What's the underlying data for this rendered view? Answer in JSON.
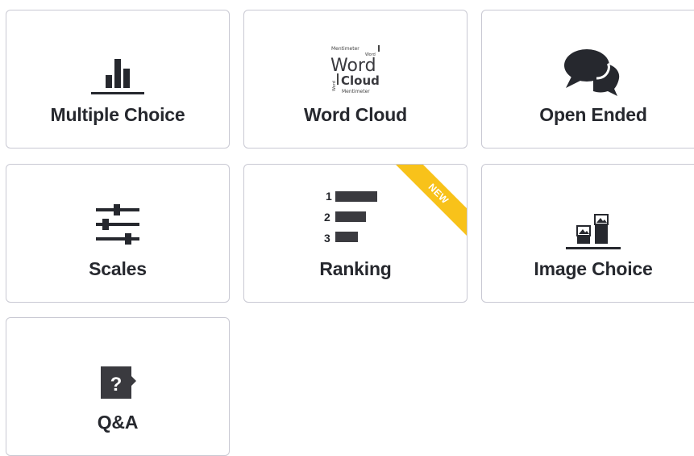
{
  "tiles": [
    {
      "key": "multiple_choice",
      "label": "Multiple Choice",
      "icon": "bar-chart-icon"
    },
    {
      "key": "word_cloud",
      "label": "Word Cloud",
      "icon": "word-cloud-icon"
    },
    {
      "key": "open_ended",
      "label": "Open Ended",
      "icon": "speech-bubbles-icon"
    },
    {
      "key": "scales",
      "label": "Scales",
      "icon": "sliders-icon"
    },
    {
      "key": "ranking",
      "label": "Ranking",
      "icon": "ranking-icon",
      "badge": "NEW"
    },
    {
      "key": "image_choice",
      "label": "Image Choice",
      "icon": "image-bar-icon"
    },
    {
      "key": "qa",
      "label": "Q&A",
      "icon": "question-box-icon"
    }
  ],
  "word_cloud_icon_text": {
    "big1": "Word",
    "big2": "Cloud",
    "small_top": "Mentimeter",
    "small_word": "Word",
    "small_bottom": "Mentimeter",
    "small_side": "Word"
  },
  "ranking_icon_numbers": [
    "1",
    "2",
    "3"
  ],
  "qa_icon_symbol": "?",
  "colors": {
    "icon": "#26282e",
    "border": "#c9c9d3",
    "badge": "#f8c21a",
    "badge_text": "#ffffff"
  }
}
